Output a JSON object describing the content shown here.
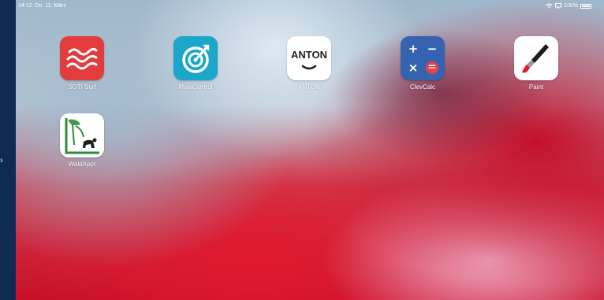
{
  "status_bar": {
    "time": "14:12",
    "date": "Do. 11. März",
    "battery": "100%"
  },
  "apps": [
    {
      "label": "SOTI Surf",
      "icon": "soti-surf-icon",
      "color": "#e23c3e"
    },
    {
      "label": "MobiControl",
      "icon": "mobicontrol-icon",
      "color": "#1aa7c9"
    },
    {
      "label": "ANTON",
      "icon": "anton-icon",
      "color": "#ffffff",
      "logo_text": "ANTON"
    },
    {
      "label": "ClevCalc",
      "icon": "clevcalc-icon",
      "color": "#3563b0",
      "symbols": [
        "+",
        "−",
        "×",
        "="
      ]
    },
    {
      "label": "Paint",
      "icon": "paint-brush-icon",
      "color": "#ffffff"
    },
    {
      "label": "WaldAppt",
      "icon": "waldappt-icon",
      "color": "#ffffff"
    }
  ]
}
